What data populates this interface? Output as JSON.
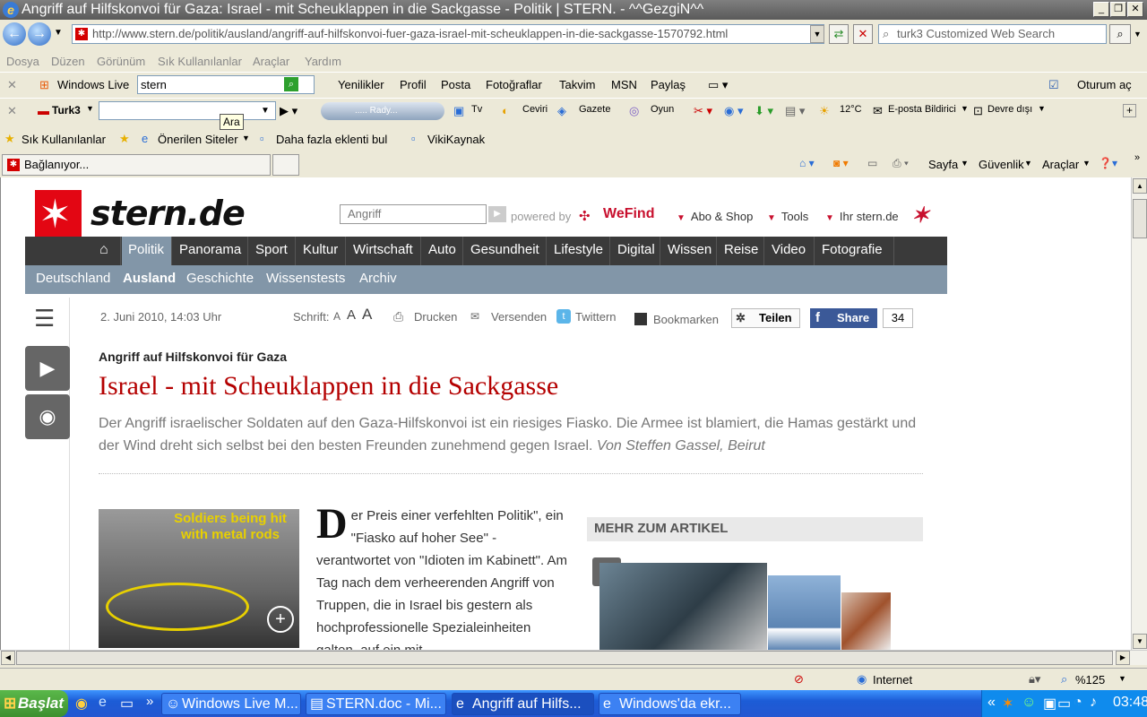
{
  "window": {
    "title": "Angriff auf Hilfskonvoi für Gaza: Israel - mit Scheuklappen in die Sackgasse - Politik | STERN. - ^^GezgiN^^"
  },
  "address": {
    "url": "http://www.stern.de/politik/ausland/angriff-auf-hilfskonvoi-fuer-gaza-israel-mit-scheuklappen-in-die-sackgasse-1570792.html",
    "search_placeholder": "turk3 Customized Web Search"
  },
  "menu": [
    "Dosya",
    "Düzen",
    "Görünüm",
    "Sık Kullanılanlar",
    "Araçlar",
    "Yardım"
  ],
  "live_toolbar": {
    "brand": "Windows Live",
    "query": "stern",
    "items": [
      "Yenilikler",
      "Profil",
      "Posta",
      "Fotoğraflar",
      "Takvim",
      "MSN",
      "Paylaş"
    ],
    "signin": "Oturum aç"
  },
  "turk3_toolbar": {
    "brand": "Turk3",
    "tooltip": "Ara",
    "radio": "..... Rady...",
    "items": [
      "Tv",
      "Ceviri",
      "Gazete",
      "Oyun"
    ],
    "weather": "12°C",
    "mail": "E-posta Bildirici",
    "offline": "Devre dışı"
  },
  "favbar": {
    "fav": "Sık Kullanılanlar",
    "items": [
      "Önerilen Siteler",
      "Daha fazla eklenti bul",
      "VikiKaynak"
    ]
  },
  "tab": {
    "label": "Bağlanıyor..."
  },
  "cmdbar": [
    "Sayfa",
    "Güvenlik",
    "Araçlar"
  ],
  "site": {
    "logo": "stern.de",
    "search_value": "Angriff",
    "powered": "powered by",
    "wefind": "WeFind",
    "toplinks": [
      "Abo & Shop",
      "Tools",
      "Ihr stern.de"
    ],
    "nav": [
      "Politik",
      "Panorama",
      "Sport",
      "Kultur",
      "Wirtschaft",
      "Auto",
      "Gesundheit",
      "Lifestyle",
      "Digital",
      "Wissen",
      "Reise",
      "Video",
      "Fotografie"
    ],
    "subnav": [
      "Deutschland",
      "Ausland",
      "Geschichte",
      "Wissenstests",
      "Archiv"
    ]
  },
  "article": {
    "date": "2. Juni 2010, 14:03 Uhr",
    "schrift": "Schrift:",
    "drucken": "Drucken",
    "versenden": "Versenden",
    "twittern": "Twittern",
    "bookmarken": "Bookmarken",
    "teilen": "Teilen",
    "share": "Share",
    "share_count": "34",
    "kicker": "Angriff auf Hilfskonvoi für Gaza",
    "headline": "Israel - mit Scheuklappen in die Sackgasse",
    "lead": "Der Angriff israelischer Soldaten auf den Gaza-Hilfskonvoi ist ein riesiges Fiasko. Die Armee ist blamiert, die Hamas gestärkt und der Wind dreht sich selbst bei den besten Freunden zunehmend gegen Israel.",
    "author": "Von Steffen Gassel, Beirut",
    "image_caption": "Soldiers being hit with metal rods",
    "dropcap": "D",
    "body": "er Preis einer verfehlten Politik\", ein \"Fiasko auf hoher See\" - verantwortet von \"Idioten im Kabinett\". Am Tag nach dem verheerenden Angriff von Truppen, die in Israel bis gestern als hochprofessionelle Spezialeinheiten galten, auf ein mit",
    "mehr": "MEHR ZUM ARTIKEL"
  },
  "status": {
    "zone": "Internet",
    "zoom": "%125"
  },
  "taskbar": {
    "start": "Başlat",
    "tasks": [
      "Windows Live M...",
      "STERN.doc - Mi...",
      "Angriff auf Hilfs...",
      "Windows'da ekr..."
    ],
    "clock": "03:48"
  }
}
